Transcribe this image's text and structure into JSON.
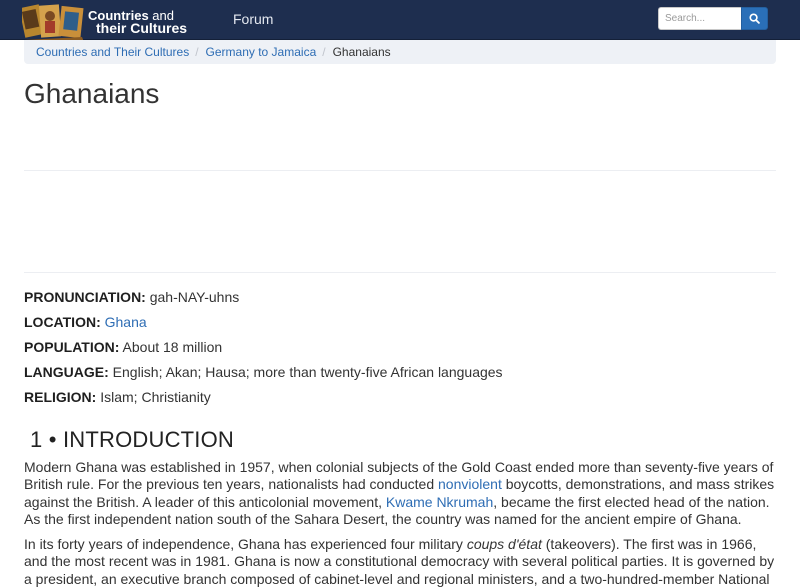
{
  "header": {
    "logo": {
      "line1_prefix": "Countries",
      "line1_suffix": "and",
      "line2": "their Cultures"
    },
    "nav_forum": "Forum",
    "search": {
      "placeholder": "Search...",
      "icon": "search-icon"
    },
    "colors": {
      "navbar": "#1e2e4f",
      "search_button": "#2a6fb8",
      "link": "#2e6db4"
    }
  },
  "breadcrumb": {
    "items": [
      "Countries and Their Cultures",
      "Germany to Jamaica"
    ],
    "separator": "/",
    "current": "Ghanaians"
  },
  "page_title": "Ghanaians",
  "facts": [
    {
      "key": "PRONUNCIATION:",
      "value": "gah-NAY-uhns"
    },
    {
      "key": "LOCATION:",
      "link": "Ghana"
    },
    {
      "key": "POPULATION:",
      "value": "About 18 million"
    },
    {
      "key": "LANGUAGE:",
      "value": "English; Akan; Hausa; more than twenty-five African languages"
    },
    {
      "key": "RELIGION:",
      "value": "Islam; Christianity"
    }
  ],
  "section": {
    "heading": "1 • INTRODUCTION"
  },
  "paragraphs": {
    "p1": {
      "part1": "Modern Ghana was established in 1957, when colonial subjects of the Gold Coast ended more than seventy-five years of British rule. For the previous ten years, nationalists had conducted ",
      "link1": "nonviolent",
      "part2": " boycotts, demonstrations, and mass strikes against the British. A leader of this anticolonial movement, ",
      "link2": "Kwame Nkrumah",
      "part3": ", became the first elected head of the nation. As the first independent nation south of the Sahara Desert, the country was named for the ancient empire of Ghana."
    },
    "p2": {
      "part1": "In its forty years of independence, Ghana has experienced four military ",
      "italic": "coups d'état",
      "part2": " (takeovers). The first was in 1966, and the most recent was in 1981. Ghana is now a constitutional democracy with several political parties. It is governed by a president, an executive branch composed of cabinet-level and regional ministers, and a two-hundred-member National Assembly."
    }
  }
}
